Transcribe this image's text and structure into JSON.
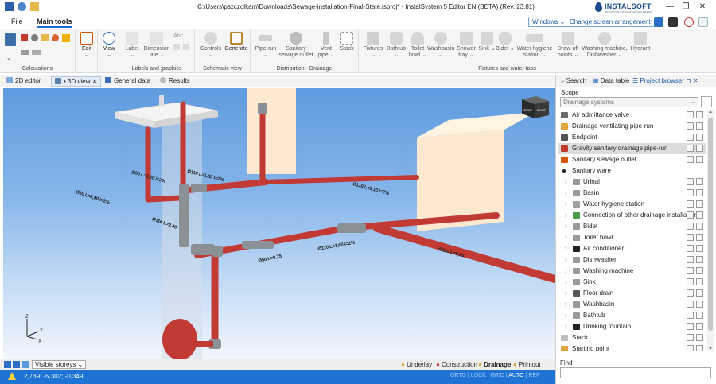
{
  "titlebar": {
    "title": "C:\\Users\\pszczolkam\\Downloads\\Sewage-installation-Final-State.isproj* - InstalSystem 5 Editor EN (BETA) (Rev. 23.81)",
    "brand": "INSTALSOFT",
    "brand_tagline": "DESIGN FOR INSTALLATION ENGINEERS",
    "minimize": "—",
    "restore": "❐",
    "close": "✕"
  },
  "menu": {
    "file": "File",
    "main_tools": "Main tools",
    "theme_combo": "Windows",
    "arrangement_combo": "Change screen arrangement"
  },
  "ribbon": {
    "calculations": "Calculations",
    "edit": "Edit",
    "view": "View",
    "label": "Label",
    "dimension_line": "Dimension line",
    "abc": "Abc",
    "labels_group": "Labels and graphics",
    "controls": "Controls",
    "generate": "Generate",
    "schematic_group": "Schematic view",
    "pipe_run": "Pipe-run",
    "sanitary_outlet": "Sanitary sewage outlet",
    "vent_pipe": "Vent pipe",
    "stack": "Stack",
    "distribution_group": "Distribution - Drainage",
    "fixtures": "Fixtures",
    "bathtub": "Bathtub",
    "toilet_bowl": "Toilet bowl",
    "washbasin": "Washbasin",
    "shower_tray": "Shower tray",
    "sink": "Sink",
    "bidet": "Bidet",
    "water_hygiene": "Water hygiene station",
    "draw_off": "Draw-off points",
    "washing_machine": "Washing machine, Dishwasher",
    "hydrant": "Hydrant",
    "fixtures_group": "Fixtures and water taps"
  },
  "doctabs": {
    "editor2d": "2D editor",
    "view3d": "• 3D view",
    "general": "General data",
    "results": "Results"
  },
  "viewport": {
    "cube_front": "FRONT",
    "cube_right": "RIGHT",
    "axis_z": "Z",
    "axis_y": "Y",
    "axis_x": "X",
    "dim_labels": [
      "Ø50 L=0,90 i=2%",
      "Ø50 L=1,20 i=2%",
      "Ø110 L=2,40",
      "Ø110 L=1,85 i=2%",
      "Ø110 L=3,10 i=2%",
      "Ø50 L=0,75",
      "Ø110 L=1,60 i=2%",
      "Ø110 L=0,95"
    ]
  },
  "bottom": {
    "visible_storeys": "Visible storeys",
    "underlay": "Underlay",
    "construction": "Construction",
    "drainage": "Drainage",
    "printout": "Printout"
  },
  "status": {
    "coords": "2,739; -5,302; -0,349",
    "snap": [
      "ORTO",
      "LOCK",
      "GRID",
      "AUTO",
      "REF"
    ],
    "snap_active": "AUTO"
  },
  "rpanel": {
    "tab_search": "Search",
    "tab_datatable": "Data table",
    "tab_project": "Project browser",
    "scope_label": "Scope",
    "scope_value": "Drainage systems",
    "find_label": "Find",
    "find_value": "",
    "tree": [
      {
        "label": "Air admittance valve",
        "indent": 0,
        "chev": false,
        "icon": "#6b6b6b",
        "sel": false,
        "btns": true
      },
      {
        "label": "Drainage ventilating pipe-run",
        "indent": 0,
        "chev": false,
        "icon": "#e0a63a",
        "sel": false,
        "btns": true
      },
      {
        "label": "Endpoint",
        "indent": 0,
        "chev": false,
        "icon": "#555555",
        "sel": false,
        "btns": true
      },
      {
        "label": "Gravity sanitary drainage pipe-run",
        "indent": 0,
        "chev": false,
        "icon": "#c0392b",
        "sel": true,
        "btns": true
      },
      {
        "label": "Sanitary sewage outlet",
        "indent": 0,
        "chev": false,
        "icon": "#d35400",
        "sel": false,
        "btns": true
      },
      {
        "label": "Sanitary ware",
        "indent": 0,
        "chev": false,
        "icon": "#222222",
        "sel": false,
        "btns": false
      },
      {
        "label": "Urinal",
        "indent": 1,
        "chev": true,
        "icon": "#9a9a9a",
        "sel": false,
        "btns": true
      },
      {
        "label": "Basin",
        "indent": 1,
        "chev": true,
        "icon": "#9a9a9a",
        "sel": false,
        "btns": true
      },
      {
        "label": "Water hygiene station",
        "indent": 1,
        "chev": true,
        "icon": "#a0a0a0",
        "sel": false,
        "btns": true
      },
      {
        "label": "Connection of other drainage installation",
        "indent": 1,
        "chev": true,
        "icon": "#4a9a4a",
        "sel": false,
        "btns": true
      },
      {
        "label": "Bidet",
        "indent": 1,
        "chev": true,
        "icon": "#9a9a9a",
        "sel": false,
        "btns": true
      },
      {
        "label": "Toilet bowl",
        "indent": 1,
        "chev": true,
        "icon": "#9a9a9a",
        "sel": false,
        "btns": true
      },
      {
        "label": "Air conditioner",
        "indent": 1,
        "chev": true,
        "icon": "#222222",
        "sel": false,
        "btns": true
      },
      {
        "label": "Dishwasher",
        "indent": 1,
        "chev": true,
        "icon": "#9a9a9a",
        "sel": false,
        "btns": true
      },
      {
        "label": "Washing machine",
        "indent": 1,
        "chev": true,
        "icon": "#9a9a9a",
        "sel": false,
        "btns": true
      },
      {
        "label": "Sink",
        "indent": 1,
        "chev": true,
        "icon": "#9a9a9a",
        "sel": false,
        "btns": true
      },
      {
        "label": "Floor drain",
        "indent": 1,
        "chev": true,
        "icon": "#555555",
        "sel": false,
        "btns": true
      },
      {
        "label": "Washbasin",
        "indent": 1,
        "chev": true,
        "icon": "#9a9a9a",
        "sel": false,
        "btns": true
      },
      {
        "label": "Bathtub",
        "indent": 1,
        "chev": true,
        "icon": "#9a9a9a",
        "sel": false,
        "btns": true
      },
      {
        "label": "Drinking fountain",
        "indent": 1,
        "chev": true,
        "icon": "#222222",
        "sel": false,
        "btns": true
      },
      {
        "label": "Stack",
        "indent": 0,
        "chev": false,
        "icon": "#bdbdbd",
        "sel": false,
        "btns": true
      },
      {
        "label": "Starting point",
        "indent": 0,
        "chev": false,
        "icon": "#e0a63a",
        "sel": false,
        "btns": true
      }
    ]
  },
  "colors": {
    "accent": "#1e74d4",
    "pipe_red": "#c23a34",
    "pipe_grey": "#8a9096",
    "room_cream": "#fde9cf"
  }
}
